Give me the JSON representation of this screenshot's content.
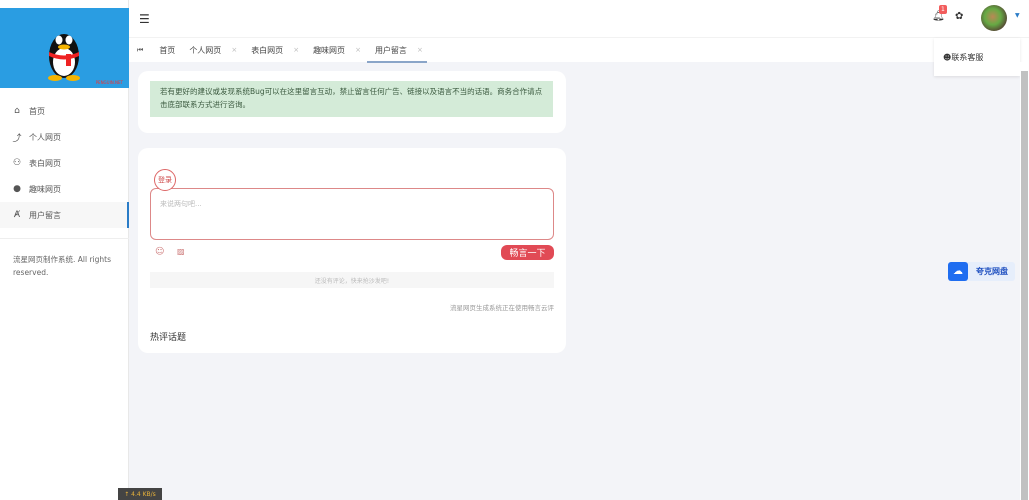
{
  "sidebar": {
    "logo_text": "PENGUIN.NET",
    "items": [
      {
        "label": "首页",
        "icon": "home-icon"
      },
      {
        "label": "个人网页",
        "icon": "person-icon"
      },
      {
        "label": "表白网页",
        "icon": "users-icon"
      },
      {
        "label": "趣味网页",
        "icon": "globe-icon"
      },
      {
        "label": "用户留言",
        "icon": "message-icon"
      }
    ],
    "active": 4,
    "copyright": "流星网页制作系统. All rights reserved."
  },
  "header": {
    "notification_count": "1",
    "dropdown_item": "联系客服"
  },
  "tabs": [
    {
      "label": "首页"
    },
    {
      "label": "个人网页",
      "close": "×"
    },
    {
      "label": "表白网页",
      "close": "×"
    },
    {
      "label": "趣味网页",
      "close": "×"
    },
    {
      "label": "用户留言",
      "close": "×"
    }
  ],
  "notice": "若有更好的建议或发现系统Bug可以在这里留言互动，禁止留言任何广告、链接以及语言不当的话语。商务合作请点击底部联系方式进行咨询。",
  "comment": {
    "login_label": "登录",
    "placeholder": "来说两句吧...",
    "send_label": "畅言一下",
    "empty_text": "还没有评论，快来抢沙发吧!",
    "powered_by": "流星网页生成系统正在使用畅言云评",
    "hot_title": "热评话题"
  },
  "quark": {
    "label": "夸克网盘"
  },
  "speed": "↑ 4.4 KB/s",
  "colors": {
    "accent": "#2a9de2",
    "send": "#e14a55",
    "notice_bg": "#d4ebd8"
  }
}
